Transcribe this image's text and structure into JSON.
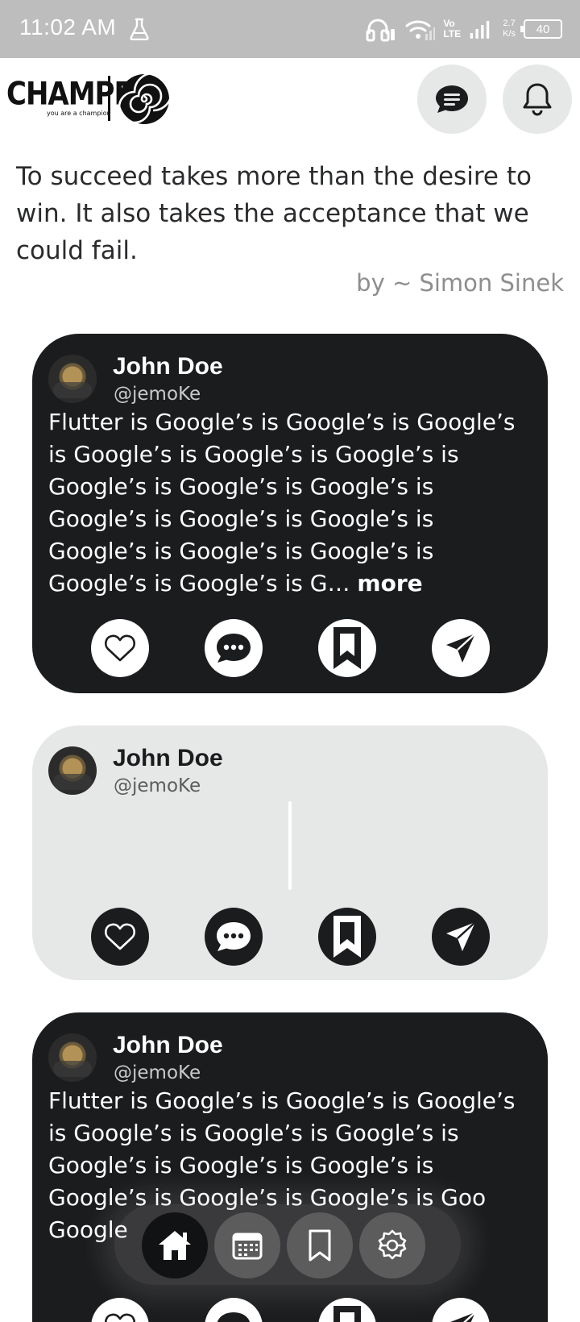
{
  "status_bar": {
    "time": "11:02 AM",
    "network_type": "Vo LTE",
    "network_top": "Vo",
    "network_bottom": "LTE",
    "speed_value": "2.7",
    "speed_unit": "K/s",
    "battery": "40",
    "icons": [
      "flask-icon",
      "headphones-icon",
      "wifi-icon",
      "signal-icon",
      "battery-icon"
    ]
  },
  "header": {
    "logo_text": "CHAMPE",
    "logo_tagline": "you are a champion",
    "icons": [
      "chat-icon",
      "bell-icon"
    ]
  },
  "quote": {
    "text": "To succeed takes more than the desire to win. It also takes the acceptance that we could fail.",
    "author": "by ~ Simon Sinek"
  },
  "posts": [
    {
      "author": "John Doe",
      "handle": "@jemoKe",
      "text": "Flutter is Google’s is Google’s is Google’s is Google’s is Google’s is Google’s is Google’s is Google’s is Google’s is Google’s is Google’s is Google’s is Google’s is Google’s is Google’s is Google’s is Google’s is G…",
      "more_label": "more",
      "theme": "dark"
    },
    {
      "author": "John Doe",
      "handle": "@jemoKe",
      "text": "",
      "theme": "light"
    },
    {
      "author": "John Doe",
      "handle": "@jemoKe",
      "text": "Flutter is Google’s is Google’s is Google’s is Google’s is Google’s is Google’s is Google’s is Google’s is Google’s is Google’s is Google’s is Google’s is Goo",
      "text_tail": "Google",
      "theme": "dark"
    }
  ],
  "post_actions": [
    "heart-icon",
    "comment-icon",
    "bookmark-icon",
    "send-icon"
  ],
  "bottom_nav": {
    "items": [
      "home-icon",
      "calendar-icon",
      "bookmark-icon",
      "settings-icon"
    ],
    "active": "home-icon"
  },
  "colors": {
    "dark_card": "#1b1c1e",
    "light_card": "#e6e7e7",
    "status_bar": "#bdbdbd",
    "author_text": "#8e8e8e"
  }
}
